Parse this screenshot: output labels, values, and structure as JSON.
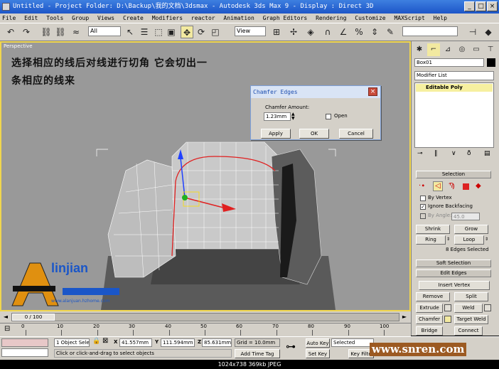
{
  "window": {
    "title": "Untitled  - Project Folder: D:\\Backup\\我的文档\\3dsmax    - Autodesk 3ds Max 9         - Display : Direct 3D"
  },
  "menu": [
    "File",
    "Edit",
    "Tools",
    "Group",
    "Views",
    "Create",
    "Modifiers",
    "reactor",
    "Animation",
    "Graph Editors",
    "Rendering",
    "Customize",
    "MAXScript",
    "Help"
  ],
  "toolbar": {
    "selection_filter": "All",
    "reference_coord": "View"
  },
  "viewport": {
    "label": "Perspective",
    "annotation_line1": "选择相应的线后对线进行切角 它会切出一",
    "annotation_line2": "条相应的线来",
    "logo_text": "linjian",
    "logo_subtext": "www.alanjuan.hzhome.com"
  },
  "dialog": {
    "title": "Chamfer Edges",
    "amount_label": "Chamfer Amount:",
    "amount_value": "1.23mm",
    "open_label": "Open",
    "apply_label": "Apply",
    "ok_label": "OK",
    "cancel_label": "Cancel"
  },
  "cmdpanel": {
    "object_name": "Box01",
    "modifier_list": "Modifier List",
    "stack_item": "Editable Poly",
    "selection_header": "Selection",
    "by_vertex": "By Vertex",
    "ignore_backfacing": "Ignore Backfacing",
    "by_angle": "By Angle:",
    "angle_value": "45.0",
    "shrink": "Shrink",
    "grow": "Grow",
    "ring": "Ring",
    "loop": "Loop",
    "selected_status": "8 Edges Selected",
    "soft_selection": "Soft Selection",
    "edit_edges": "Edit Edges",
    "insert_vertex": "Insert Vertex",
    "remove": "Remove",
    "split": "Split",
    "extrude": "Extrude",
    "weld": "Weld",
    "chamfer": "Chamfer",
    "target_weld": "Target Weld",
    "bridge": "Bridge",
    "connect": "Connect"
  },
  "timeline": {
    "frame_counter": "0 / 100",
    "ticks": [
      "0",
      "10",
      "20",
      "30",
      "40",
      "50",
      "60",
      "70",
      "80",
      "90",
      "100"
    ]
  },
  "status": {
    "selection_count": "1 Object Sele",
    "prompt": "Click or click-and-drag to select objects",
    "x_label": "X",
    "x_value": "41.557mm",
    "y_label": "Y",
    "y_value": "111.594mm",
    "z_label": "Z",
    "z_value": "85.631mm",
    "grid": "Grid = 10.0mm",
    "add_time_tag": "Add Time Tag",
    "auto_key": "Auto Key",
    "set_key": "Set Key",
    "key_mode": "Selected",
    "key_filters": "Key Filte"
  },
  "watermark": "www.snren.com",
  "caption": "1024x738  369kb  JPEG"
}
